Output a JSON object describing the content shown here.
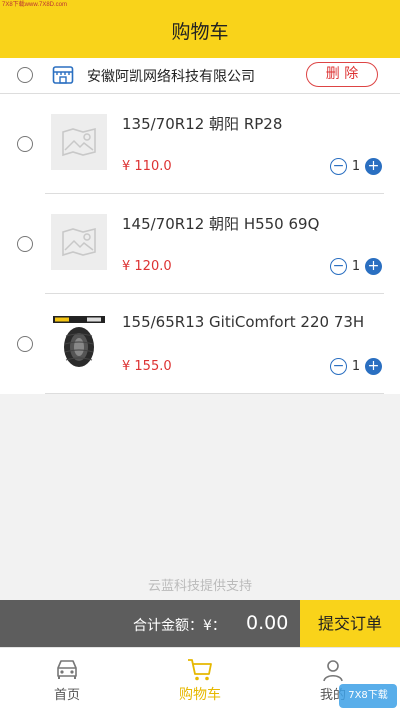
{
  "watermark_top": "7X8下载www.7X8D.com",
  "header": {
    "title": "购物车"
  },
  "store": {
    "name": "安徽阿凯网络科技有限公司",
    "delete_label": "删 除"
  },
  "items": [
    {
      "name": "135/70R12 朝阳 RP28",
      "price": "¥ 110.0",
      "qty": "1",
      "thumb": "placeholder-image-icon"
    },
    {
      "name": "145/70R12 朝阳 H550 69Q",
      "price": "¥ 120.0",
      "qty": "1",
      "thumb": "placeholder-image-icon"
    },
    {
      "name": "155/65R13 GitiComfort 220 73H",
      "price": "¥ 155.0",
      "qty": "1",
      "thumb": "tire-product-image"
    }
  ],
  "qty_controls": {
    "minus": "−",
    "plus": "+"
  },
  "support_text": "云蓝科技提供支持",
  "checkout": {
    "total_label": "合计金额：¥：",
    "total_value": "0.00",
    "submit_label": "提交订单"
  },
  "tabs": [
    {
      "label": "首页",
      "icon": "car-icon"
    },
    {
      "label": "购物车",
      "icon": "cart-icon",
      "active": true
    },
    {
      "label": "我的",
      "icon": "user-icon"
    }
  ],
  "colors": {
    "brand_yellow": "#f9d31a",
    "price_red": "#d33",
    "qty_blue": "#2a6fc1",
    "checkout_gray": "#5d5d5d"
  },
  "corner_watermark": "7X8下载"
}
